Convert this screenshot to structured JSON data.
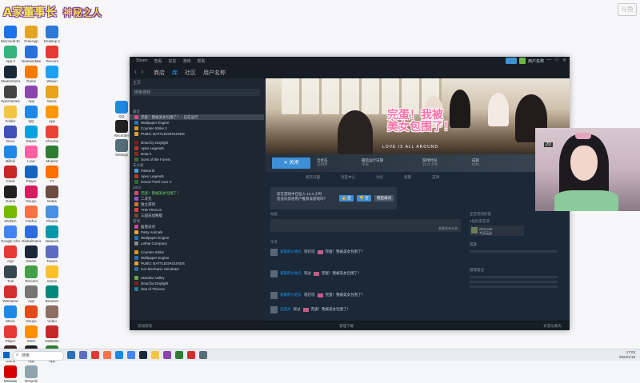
{
  "overlay": {
    "streamer_name": "A家董事长",
    "tag": "神秘之人",
    "watermark": "斗鱼"
  },
  "desktop": {
    "icons": [
      {
        "label": "Microsoft Edge",
        "color": "#1a73e8"
      },
      {
        "label": "FreeApp",
        "color": "#e5a425"
      },
      {
        "label": "Desktop 1",
        "color": "#2b7bd6"
      },
      {
        "label": "App 2",
        "color": "#36b37e"
      },
      {
        "label": "NeteaseMail",
        "color": "#2a6fdb"
      },
      {
        "label": "Tencent",
        "color": "#e53935"
      },
      {
        "label": "SteamGame",
        "color": "#1b2838"
      },
      {
        "label": "Game",
        "color": "#f57c00"
      },
      {
        "label": "Weixin",
        "color": "#1ea1f2"
      },
      {
        "label": "EpicGames",
        "color": "#444"
      },
      {
        "label": "App",
        "color": "#8e44ad"
      },
      {
        "label": "Music",
        "color": "#e8a31b"
      },
      {
        "label": "Folder",
        "color": "#f4c542"
      },
      {
        "label": "QQ",
        "color": "#1e88e5"
      },
      {
        "label": "App",
        "color": "#ff9800"
      },
      {
        "label": "Docs",
        "color": "#3f51b5"
      },
      {
        "label": "Steam",
        "color": "#00a3e0"
      },
      {
        "label": "Chrome",
        "color": "#ea4335"
      },
      {
        "label": "Bilibili",
        "color": "#1e88e5"
      },
      {
        "label": "Love",
        "color": "#ff5fa2"
      },
      {
        "label": "Monitor",
        "color": "#2e7d32"
      },
      {
        "label": "Clock",
        "color": "#c62828"
      },
      {
        "label": "Player",
        "color": "#1565c0"
      },
      {
        "label": "YY",
        "color": "#ff6f00"
      },
      {
        "label": "Game",
        "color": "#212121"
      },
      {
        "label": "Douyu",
        "color": "#d81b60"
      },
      {
        "label": "Notes",
        "color": "#6d4c41"
      },
      {
        "label": "NVIDIA",
        "color": "#76b900"
      },
      {
        "label": "Firefox",
        "color": "#ff7043"
      },
      {
        "label": "Photos",
        "color": "#4a90e2"
      },
      {
        "label": "Google Chrome",
        "color": "#4285f4"
      },
      {
        "label": "GlobalGame",
        "color": "#2d6cdf"
      },
      {
        "label": "Network",
        "color": "#0097a7"
      },
      {
        "label": "App",
        "color": "#e53935"
      },
      {
        "label": "Steam",
        "color": "#1b2838"
      },
      {
        "label": "Teams",
        "color": "#5c6bc0"
      },
      {
        "label": "Tool",
        "color": "#37474f"
      },
      {
        "label": "Tencent",
        "color": "#43a047"
      },
      {
        "label": "Game",
        "color": "#fbc02d"
      },
      {
        "label": "WeGame",
        "color": "#d32f2f"
      },
      {
        "label": "App",
        "color": "#757575"
      },
      {
        "label": "Browser",
        "color": "#00897b"
      },
      {
        "label": "Music",
        "color": "#1e88e5"
      },
      {
        "label": "Douyu",
        "color": "#e64a19"
      },
      {
        "label": "Video",
        "color": "#8d6e63"
      },
      {
        "label": "Player",
        "color": "#e53935"
      },
      {
        "label": "Store",
        "color": "#ff8f00"
      },
      {
        "label": "NetEase",
        "color": "#c62828"
      },
      {
        "label": "Game",
        "color": "#3e2723"
      },
      {
        "label": "App",
        "color": "#212121"
      },
      {
        "label": "App",
        "color": "#2e7d32"
      },
      {
        "label": "Netease",
        "color": "#d50000"
      },
      {
        "label": "Recycle",
        "color": "#90a4ae"
      }
    ],
    "mid_icons": [
      {
        "label": "QQ",
        "color": "#1e88e5"
      },
      {
        "label": "Recorder",
        "color": "#212121"
      },
      {
        "label": "Settings",
        "color": "#546e7a"
      }
    ]
  },
  "steam": {
    "menus": [
      "Steam",
      "查看",
      "好友",
      "游戏",
      "帮助"
    ],
    "account_name": "用户名称",
    "nav_tabs": [
      "商店",
      "库",
      "社区",
      "用户名称"
    ],
    "nav_active_index": 1,
    "sidebar": {
      "home": "主页",
      "filter_placeholder": "搜索游戏",
      "sections": [
        {
          "title": "最近",
          "items": [
            {
              "name": "完蛋！我被美女包围了！ - 已在运行",
              "color": "#d94b7a",
              "selected": true
            },
            {
              "name": "Wallpaper Engine",
              "color": "#2a6fb5"
            },
            {
              "name": "Counter-Strike 2",
              "color": "#d69a1a"
            },
            {
              "name": "PUBG: BATTLEGROUNDS",
              "color": "#e3a33a"
            }
          ]
        },
        {
          "title": "",
          "items": [
            {
              "name": "Dead by Daylight",
              "color": "#7b1f1f"
            },
            {
              "name": "Apex Legends",
              "color": "#b33a2a"
            },
            {
              "name": "Dota 2",
              "color": "#8a2a20"
            },
            {
              "name": "Sons of the Forest",
              "color": "#4a6a3a"
            }
          ]
        },
        {
          "title": "未分类",
          "items": [
            {
              "name": "Palworld",
              "color": "#4aa3d8"
            },
            {
              "name": "Apex Legends",
              "color": "#b33a2a"
            },
            {
              "name": "Grand Theft Auto V",
              "color": "#2f6d34"
            }
          ]
        },
        {
          "title": "2023",
          "items": [
            {
              "name": "完蛋！我被美女包围了！",
              "color": "#d94b7a",
              "highlight": true
            },
            {
              "name": "二次元",
              "color": "#9a55c8"
            },
            {
              "name": "独立游戏",
              "color": "#cf7a2a"
            },
            {
              "name": "THE FINALS",
              "color": "#d9473f"
            },
            {
              "name": "三国志战略版",
              "color": "#6b4a2a"
            }
          ]
        },
        {
          "title": "游戏",
          "items": [
            {
              "name": "猛兽派对",
              "color": "#c94b9a"
            },
            {
              "name": "Party Animals",
              "color": "#f0a43a"
            },
            {
              "name": "Wallpaper Engine",
              "color": "#2a6fb5"
            },
            {
              "name": "Lethal Company",
              "color": "#8a8a8a"
            }
          ]
        },
        {
          "title": "",
          "items": [
            {
              "name": "Counter-Strike",
              "color": "#d69a1a"
            },
            {
              "name": "Wallpaper Engine",
              "color": "#2a6fb5"
            },
            {
              "name": "PUBG: BATTLEGROUNDS",
              "color": "#e3a33a"
            },
            {
              "name": "Car Mechanic Simulator",
              "color": "#3a6a9a"
            }
          ]
        },
        {
          "title": "",
          "items": [
            {
              "name": "Stardew Valley",
              "color": "#6aa84f"
            },
            {
              "name": "Dead by Daylight",
              "color": "#7b1f1f"
            },
            {
              "name": "Sea of Thieves",
              "color": "#2a7a9a"
            }
          ]
        }
      ]
    },
    "hero": {
      "title_line1": "完蛋！我被",
      "title_line2": "美女包围了！",
      "subtitle": "LOVE IS ALL AROUND"
    },
    "action": {
      "close_label": "✕ 关闭",
      "stats": [
        {
          "label": "云状态",
          "value": "已同步"
        },
        {
          "label": "最后运行日期",
          "value": "今天"
        },
        {
          "label": "游戏时间",
          "value": "12.3 小时"
        },
        {
          "label": "成就",
          "value": "5/20"
        }
      ]
    },
    "subnav": [
      "商店页面",
      "社区中心",
      "讨论",
      "指南",
      "支持"
    ],
    "rating": {
      "question": "您在游戏中已投入 12.3 小时",
      "question2": "您会向其他用户推荐该游戏吗？",
      "yes": "是",
      "no": "否",
      "later": "稍后再问"
    },
    "activity": {
      "header": "动态",
      "link": "查看所有动态",
      "date": "今天",
      "items": [
        {
          "user": "道家的小佐久",
          "action": "现在玩",
          "game": "完蛋！我被美女包围了！"
        },
        {
          "user": "道家的小佐久",
          "action": "玩过",
          "game": "完蛋！我被美女包围了！"
        },
        {
          "user": "道家的小佐久",
          "action": "现在玩",
          "game": "完蛋！我被美女包围了！"
        },
        {
          "user": "迈克尔",
          "action": "玩过",
          "game": "完蛋！我被美女包围了！"
        },
        {
          "user": "道家的小佐久",
          "action": "玩过",
          "game": "完蛋！我被美女包围了！"
        }
      ]
    },
    "right_panel": {
      "friends_header": "正在玩的好友",
      "friend_count": "1位好友在玩",
      "friend_name": "OFFLINE",
      "friend_status": "今天玩过",
      "achievements_header": "成就",
      "notes_header": "游戏笔记"
    },
    "status": {
      "left": "添加游戏",
      "center": "管理下载",
      "right": "好友与聊天"
    }
  },
  "webcam": {
    "badge": "20"
  },
  "taskbar": {
    "search_placeholder": "搜索",
    "apps": [
      "#2a6fb5",
      "#5c6bc0",
      "#e53935",
      "#ff7043",
      "#1e88e5",
      "#4285f4",
      "#1b2838",
      "#f4c542",
      "#8e44ad",
      "#2e7d32",
      "#d32f2f",
      "#546e7a"
    ],
    "time": "17:03",
    "date": "2024/1/18"
  }
}
